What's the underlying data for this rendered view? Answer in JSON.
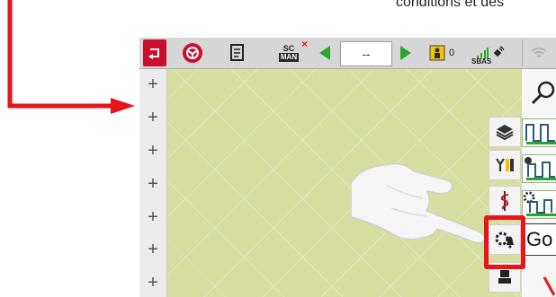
{
  "caption": {
    "text": "conditions et des"
  },
  "toolbar": {
    "sc_label": "SC",
    "man_label": "MAN",
    "section_value": "--",
    "count_value": "0",
    "sbas_label": "SBAS"
  },
  "left_column": {
    "plus_symbol": "+"
  },
  "right_panel": {
    "go_text": "Go"
  },
  "colors": {
    "highlight": "#e8141c",
    "toolbar_bg": "#d6d6d6",
    "field_bg": "#d7dea0",
    "back_button": "#c8102e",
    "green_arrow": "#2ca52c"
  }
}
